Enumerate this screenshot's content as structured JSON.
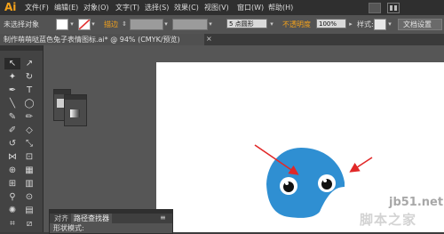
{
  "app": {
    "logo": "Ai"
  },
  "menu": [
    "文件(F)",
    "编辑(E)",
    "对象(O)",
    "文字(T)",
    "选择(S)",
    "效果(C)",
    "视图(V)",
    "窗口(W)",
    "帮助(H)"
  ],
  "control_bar": {
    "selection": "未选择对象",
    "stroke_label": "描边",
    "brush": "5 点圆形",
    "opacity_label": "不透明度",
    "opacity_value": "100%",
    "style_label": "样式:",
    "doc_setup": "文档设置"
  },
  "document_tab": {
    "label": "制作萌萌哒蓝色兔子表情图标.ai* @ 94% (CMYK/预览)",
    "close": "×"
  },
  "pathfinder_panel": {
    "tabs": [
      "对齐",
      "路径查找器"
    ],
    "shape_modes": "形状模式:"
  },
  "watermark": {
    "line1": "jb51.net",
    "line2": "脚本之家"
  },
  "colors": {
    "accent": "#f4a21b",
    "creature_blue": "#2f8fd2",
    "annotation_arrow": "#e12828"
  }
}
